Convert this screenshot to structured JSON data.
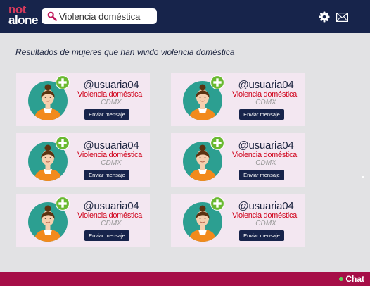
{
  "header": {
    "logo_top": "not",
    "logo_bottom": "alone",
    "search": {
      "value": "Violencia doméstica",
      "placeholder": ""
    }
  },
  "page": {
    "heading": "Resultados de mujeres que han vivido violencia doméstica"
  },
  "results": [
    {
      "username": "@usuaria04",
      "category": "Violencia doméstica",
      "location": "CDMX",
      "button": "Enviar mensaje"
    },
    {
      "username": "@usuaria04",
      "category": "Violencia doméstica",
      "location": "CDMX",
      "button": "Enviar mensaje"
    },
    {
      "username": "@usuaria04",
      "category": "Violencia doméstica",
      "location": "CDMX",
      "button": "Enviar mensaje"
    },
    {
      "username": "@usuaria04",
      "category": "Violencia doméstica",
      "location": "CDMX",
      "button": "Enviar mensaje"
    },
    {
      "username": "@usuaria04",
      "category": "Violencia doméstica",
      "location": "CDMX",
      "button": "Enviar mensaje"
    },
    {
      "username": "@usuaria04",
      "category": "Violencia doméstica",
      "location": "CDMX",
      "button": "Enviar mensaje"
    }
  ],
  "footer": {
    "chat_label": "Chat"
  },
  "icons": {
    "search": "search-icon",
    "settings": "gear-icon",
    "messages": "mail-icon",
    "add": "plus-icon",
    "avatar": "avatar-icon"
  },
  "colors": {
    "header_bg": "#17244b",
    "footer_bg": "#a60e47",
    "card_bg": "#f3e7f1",
    "add_green": "#6ab931",
    "category_red": "#d0021b",
    "avatar_teal": "#2c9f91",
    "online_green": "#5fd35f"
  }
}
